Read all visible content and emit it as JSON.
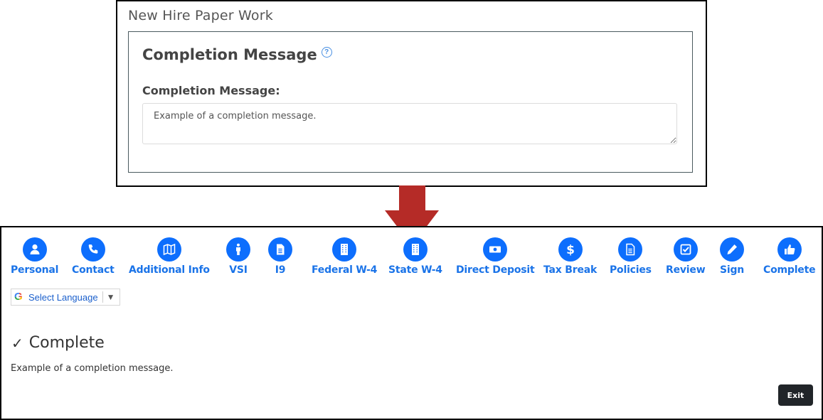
{
  "editor": {
    "title": "New Hire Paper Work",
    "heading": "Completion Message",
    "help_icon": "question-circle-icon",
    "field_label": "Completion Message:",
    "field_value": "Example of a completion message."
  },
  "arrow": {
    "color": "#b52b27"
  },
  "steps": [
    {
      "label": "Personal",
      "icon": "person-icon"
    },
    {
      "label": "Contact",
      "icon": "phone-icon"
    },
    {
      "label": "Additional Info",
      "icon": "map-icon"
    },
    {
      "label": "VSI",
      "icon": "standing-person-icon"
    },
    {
      "label": "I9",
      "icon": "document-icon"
    },
    {
      "label": "Federal W-4",
      "icon": "building-icon"
    },
    {
      "label": "State W-4",
      "icon": "building-icon"
    },
    {
      "label": "Direct Deposit",
      "icon": "money-bill-icon"
    },
    {
      "label": "Tax Break",
      "icon": "dollar-icon"
    },
    {
      "label": "Policies",
      "icon": "document-icon"
    },
    {
      "label": "Review",
      "icon": "check-square-icon"
    },
    {
      "label": "Sign",
      "icon": "pencil-icon"
    },
    {
      "label": "Complete",
      "icon": "thumbs-up-icon"
    }
  ],
  "language": {
    "label": "Select Language",
    "caret": "▼"
  },
  "complete": {
    "check": "✓",
    "heading": "Complete",
    "message": "Example of a completion message."
  },
  "exit_label": "Exit",
  "colors": {
    "accent": "#0d6efd",
    "step_text": "#1a73e8",
    "exit_bg": "#212529"
  }
}
